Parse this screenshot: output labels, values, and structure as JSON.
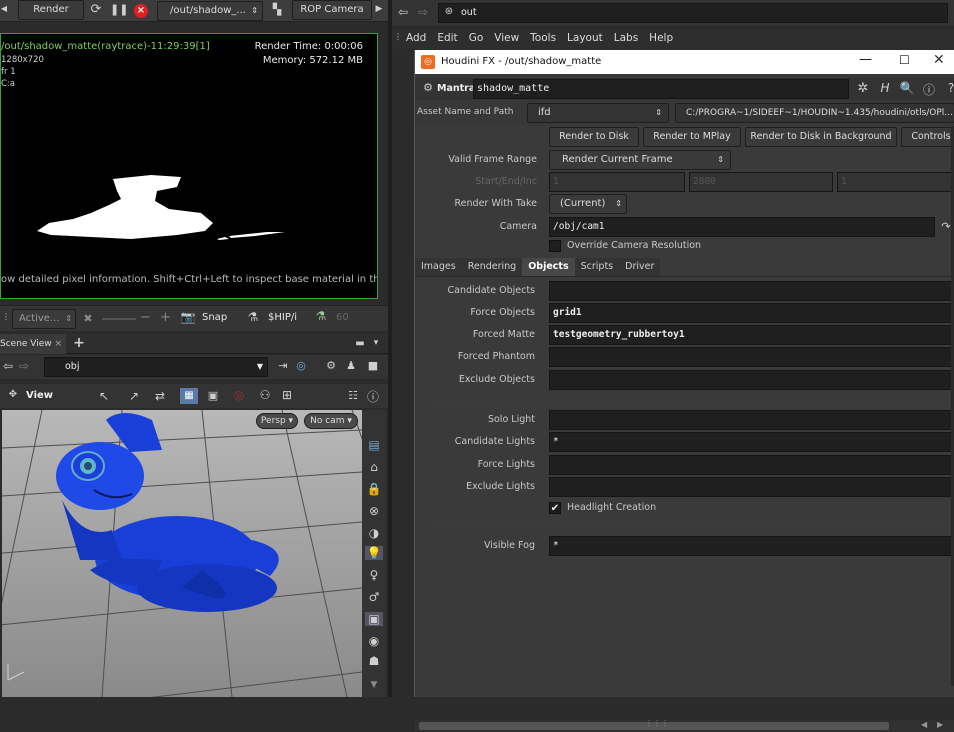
{
  "render_toolbar": {
    "render_label": "Render",
    "path_value": "/out/shadow_...",
    "camera_label": "ROP Camera"
  },
  "render_view": {
    "info_line1": "/out/shadow_matte(raytrace)-11:29:39[1]",
    "info_line2": "1280x720",
    "info_line3": "fr 1",
    "info_line4": "C:a",
    "time_line": "Render Time: 0:00:06",
    "memory_line": "Memory:  572.12 MB",
    "status_text": "ow detailed pixel information. Shift+Ctrl+Left to inspect base material in the para"
  },
  "bottom_toolbar": {
    "active_label": "Active...",
    "snap_label": "Snap",
    "hip_label": "$HIP/i",
    "num_label": "60"
  },
  "scene_view": {
    "tab_label": "Scene View",
    "path_value": "obj",
    "view_label": "View",
    "persp_label": "Persp",
    "cam_label": "No cam"
  },
  "network": {
    "path_value": "out"
  },
  "menu": [
    "Add",
    "Edit",
    "Go",
    "View",
    "Tools",
    "Layout",
    "Labs",
    "Help"
  ],
  "dialog": {
    "title": "Houdini FX - /out/shadow_matte",
    "node_type": "Mantra",
    "node_name": "shadow_matte",
    "asset_label": "Asset Name and Path",
    "asset_value": "ifd",
    "asset_path": "C:/PROGRA~1/SIDEEF~1/HOUDIN~1.435/houdini/otls/OPl...",
    "buttons": [
      "Render to Disk",
      "Render to MPlay",
      "Render to Disk in Background",
      "Controls"
    ],
    "valid_frame_label": "Valid Frame Range",
    "valid_frame_value": "Render Current Frame",
    "start_label": "Start/End/Inc",
    "start_values": [
      "1",
      "2800",
      "1"
    ],
    "take_label": "Render With Take",
    "take_value": "(Current)",
    "camera_label": "Camera",
    "camera_value": "/obj/cam1",
    "override_label": "Override Camera Resolution",
    "tabs": [
      "Images",
      "Rendering",
      "Objects",
      "Scripts",
      "Driver"
    ],
    "active_tab": "Objects",
    "objects": [
      {
        "label": "Candidate Objects",
        "value": ""
      },
      {
        "label": "Force Objects",
        "value": "grid1"
      },
      {
        "label": "Forced Matte",
        "value": "testgeometry_rubbertoy1"
      },
      {
        "label": "Forced Phantom",
        "value": ""
      },
      {
        "label": "Exclude Objects",
        "value": ""
      }
    ],
    "lights": [
      {
        "label": "Solo Light",
        "value": ""
      },
      {
        "label": "Candidate Lights",
        "value": "*"
      },
      {
        "label": "Force Lights",
        "value": ""
      },
      {
        "label": "Exclude Lights",
        "value": ""
      }
    ],
    "headlight_label": "Headlight Creation",
    "fog_label": "Visible Fog",
    "fog_value": "*"
  },
  "colors": {
    "accent_green": "#7fcf5f",
    "close_red": "#e81123",
    "viewport_sky": "#a8a8a8",
    "toy_blue": "#1a3fd8"
  }
}
